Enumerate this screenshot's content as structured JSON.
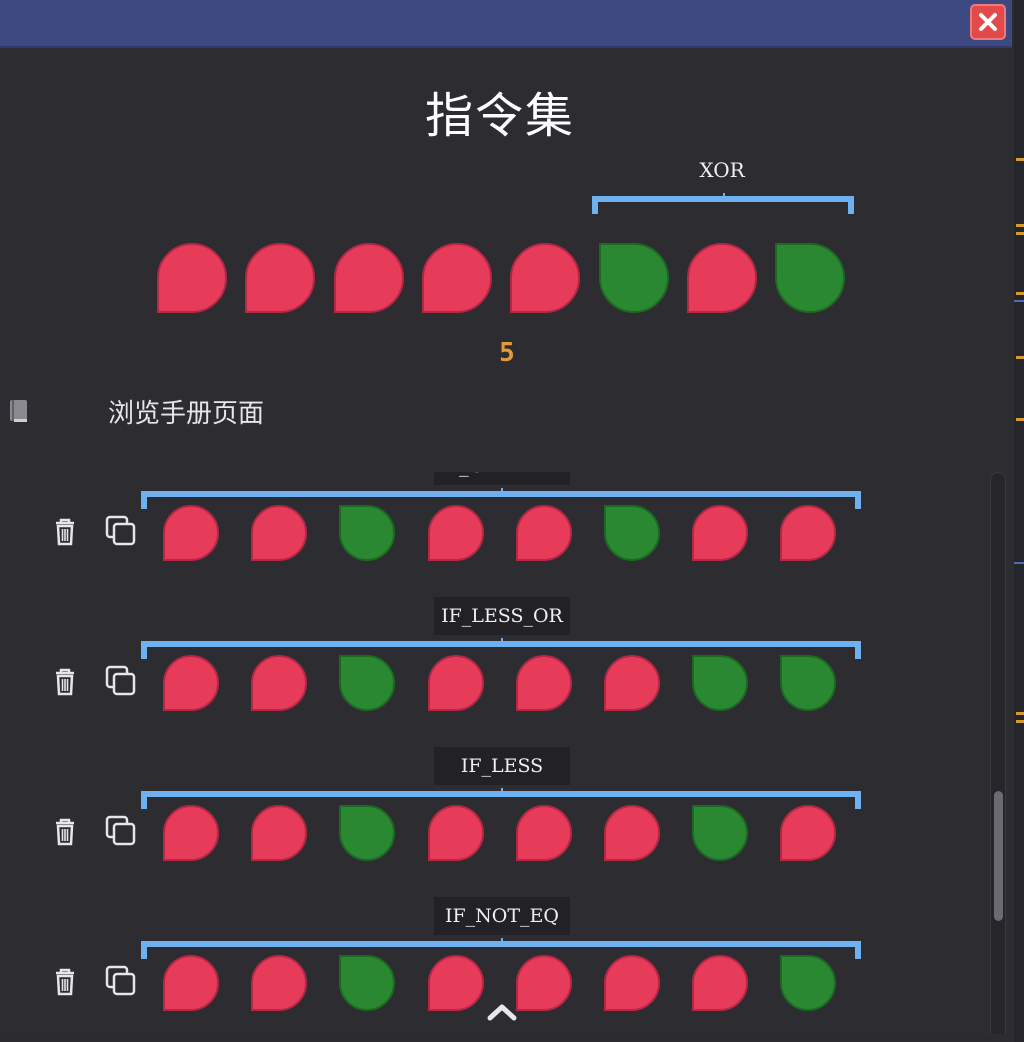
{
  "window": {
    "close_icon": "close-x-icon",
    "close_color": "#e24a4a"
  },
  "title": "指令集",
  "current": {
    "label": "XOR",
    "bits": [
      "red",
      "red",
      "red",
      "red",
      "red",
      "green",
      "red",
      "green"
    ],
    "value": "5"
  },
  "manual": {
    "icon": "book-icon",
    "label": "浏览手册页面"
  },
  "colors": {
    "on": "#2a8732",
    "off": "#e63c5a",
    "bracket": "#6fb0f0",
    "value": "#e39a3a"
  },
  "instructions": [
    {
      "label": "IF_GREATER",
      "bits": [
        "red",
        "red",
        "green",
        "red",
        "red",
        "green",
        "red",
        "red"
      ]
    },
    {
      "label": "IF_LESS_OR",
      "bits": [
        "red",
        "red",
        "green",
        "red",
        "red",
        "red",
        "green",
        "green"
      ]
    },
    {
      "label": "IF_LESS",
      "bits": [
        "red",
        "red",
        "green",
        "red",
        "red",
        "red",
        "green",
        "red"
      ]
    },
    {
      "label": "IF_NOT_EQ",
      "bits": [
        "red",
        "red",
        "green",
        "red",
        "red",
        "red",
        "red",
        "green"
      ]
    }
  ],
  "row_actions": {
    "delete_icon": "trash-icon",
    "copy_icon": "copy-icon"
  },
  "scroll_up_icon": "chevron-up-icon"
}
